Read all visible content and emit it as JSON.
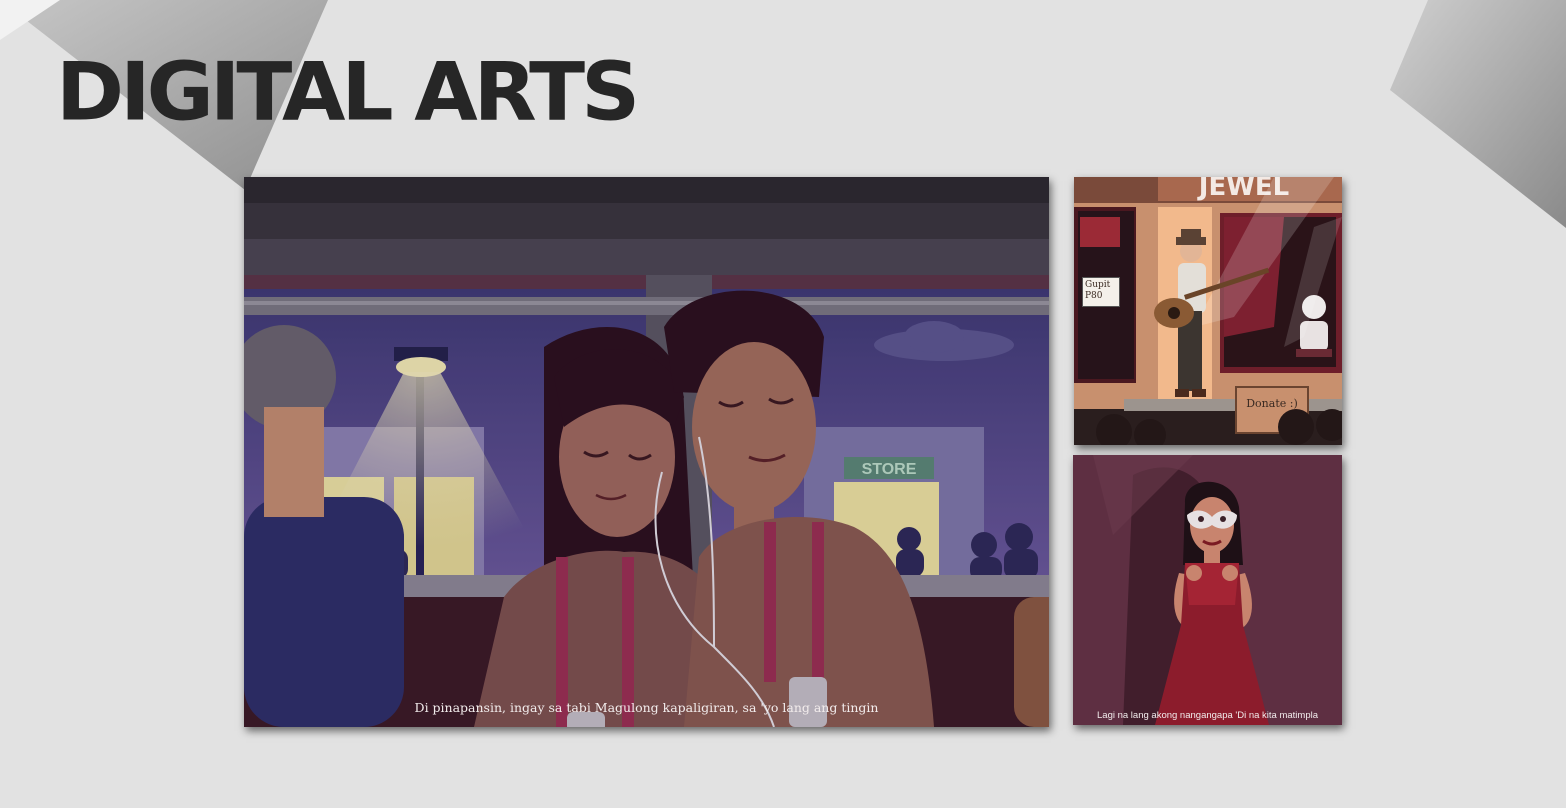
{
  "page": {
    "title": "DIGITAL ARTS",
    "accent_color": "#262626",
    "background_color": "#e2e2e2"
  },
  "gallery": {
    "main": {
      "caption": "Di pinapansin, ingay sa tabi Magulong kapaligiran, sa 'yo lang ang tingin",
      "window_sign": "STORE"
    },
    "busker": {
      "shop_sign": "JEWEL",
      "price_sign": "Gupit P80",
      "donate_box": "Donate :)"
    },
    "masked": {
      "caption": "Lagi na lang akong nangangapa 'Di na kita matimpla"
    }
  }
}
